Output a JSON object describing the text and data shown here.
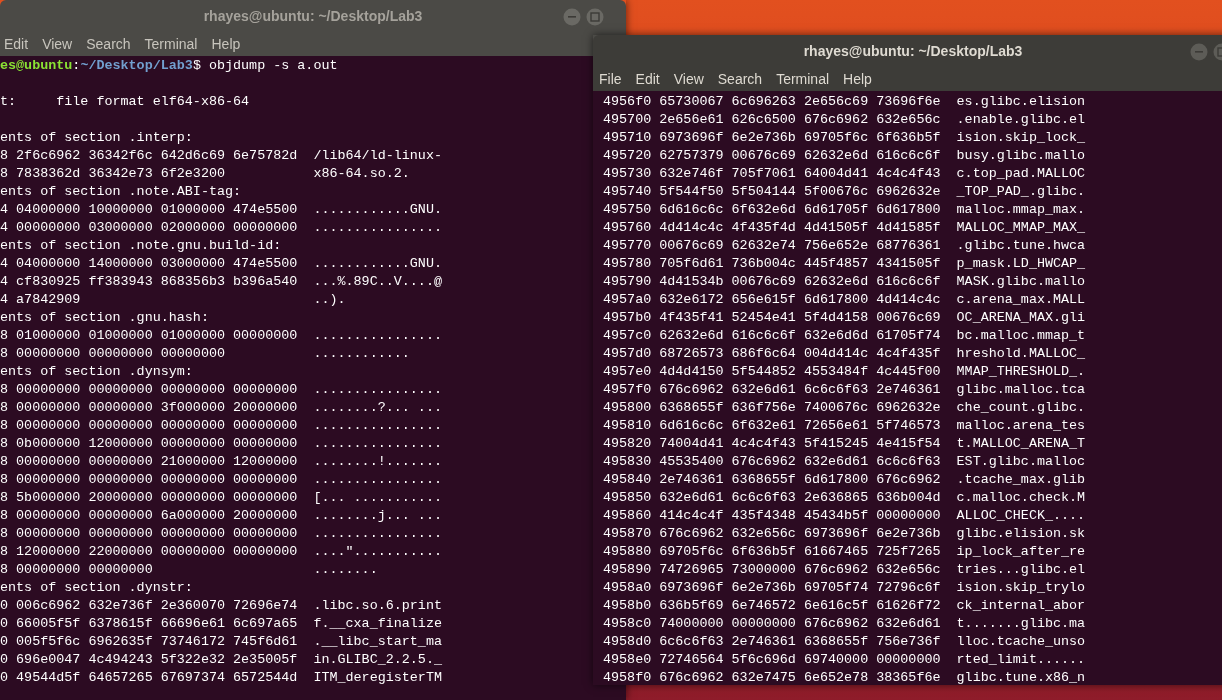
{
  "windows": [
    {
      "title": "rhayes@ubuntu: ~/Desktop/Lab3",
      "focused": false,
      "menu": [
        "Edit",
        "View",
        "Search",
        "Terminal",
        "Help"
      ],
      "prompt": {
        "user": "es@ubuntu",
        "separator": ":",
        "path": "~/Desktop/Lab3",
        "command": "$ objdump -s a.out"
      },
      "lines": [
        {
          "kind": "blank"
        },
        {
          "kind": "text",
          "text": "t:     file format elf64-x86-64"
        },
        {
          "kind": "blank"
        },
        {
          "kind": "text",
          "text": "ents of section .interp:"
        },
        {
          "kind": "text",
          "text": "8 2f6c6962 36342f6c 642d6c69 6e75782d  /lib64/ld-linux-"
        },
        {
          "kind": "text",
          "text": "8 7838362d 36342e73 6f2e3200           x86-64.so.2."
        },
        {
          "kind": "text",
          "text": "ents of section .note.ABI-tag:"
        },
        {
          "kind": "text",
          "text": "4 04000000 10000000 01000000 474e5500  ............GNU."
        },
        {
          "kind": "text",
          "text": "4 00000000 03000000 02000000 00000000  ................"
        },
        {
          "kind": "text",
          "text": "ents of section .note.gnu.build-id:"
        },
        {
          "kind": "text",
          "text": "4 04000000 14000000 03000000 474e5500  ............GNU."
        },
        {
          "kind": "text",
          "text": "4 cf830925 ff383943 868356b3 b396a540  ...%.89C..V....@"
        },
        {
          "kind": "text",
          "text": "4 a7842909                             ..)."
        },
        {
          "kind": "text",
          "text": "ents of section .gnu.hash:"
        },
        {
          "kind": "text",
          "text": "8 01000000 01000000 01000000 00000000  ................"
        },
        {
          "kind": "text",
          "text": "8 00000000 00000000 00000000           ............"
        },
        {
          "kind": "text",
          "text": "ents of section .dynsym:"
        },
        {
          "kind": "text",
          "text": "8 00000000 00000000 00000000 00000000  ................"
        },
        {
          "kind": "text",
          "text": "8 00000000 00000000 3f000000 20000000  ........?... ..."
        },
        {
          "kind": "text",
          "text": "8 00000000 00000000 00000000 00000000  ................"
        },
        {
          "kind": "text",
          "text": "8 0b000000 12000000 00000000 00000000  ................"
        },
        {
          "kind": "text",
          "text": "8 00000000 00000000 21000000 12000000  ........!......."
        },
        {
          "kind": "text",
          "text": "8 00000000 00000000 00000000 00000000  ................"
        },
        {
          "kind": "text",
          "text": "8 5b000000 20000000 00000000 00000000  [... ..........."
        },
        {
          "kind": "text",
          "text": "8 00000000 00000000 6a000000 20000000  ........j... ..."
        },
        {
          "kind": "text",
          "text": "8 00000000 00000000 00000000 00000000  ................"
        },
        {
          "kind": "text",
          "text": "8 12000000 22000000 00000000 00000000  ....\"..........."
        },
        {
          "kind": "text",
          "text": "8 00000000 00000000                    ........"
        },
        {
          "kind": "text",
          "text": "ents of section .dynstr:"
        },
        {
          "kind": "text",
          "text": "0 006c6962 632e736f 2e360070 72696e74  .libc.so.6.print"
        },
        {
          "kind": "text",
          "text": "0 66005f5f 6378615f 66696e61 6c697a65  f.__cxa_finalize"
        },
        {
          "kind": "text",
          "text": "0 005f5f6c 6962635f 73746172 745f6d61  .__libc_start_ma"
        },
        {
          "kind": "text",
          "text": "0 696e0047 4c494243 5f322e32 2e35005f  in.GLIBC_2.2.5._"
        },
        {
          "kind": "text",
          "text": "0 49544d5f 64657265 67697374 6572544d  ITM_deregisterTM"
        }
      ]
    },
    {
      "title": "rhayes@ubuntu: ~/Desktop/Lab3",
      "focused": true,
      "menu": [
        "File",
        "Edit",
        "View",
        "Search",
        "Terminal",
        "Help"
      ],
      "lines": [
        {
          "kind": "text",
          "text": "4956f0 65730067 6c696263 2e656c69 73696f6e  es.glibc.elision"
        },
        {
          "kind": "text",
          "text": "495700 2e656e61 626c6500 676c6962 632e656c  .enable.glibc.el"
        },
        {
          "kind": "text",
          "text": "495710 6973696f 6e2e736b 69705f6c 6f636b5f  ision.skip_lock_"
        },
        {
          "kind": "text",
          "text": "495720 62757379 00676c69 62632e6d 616c6c6f  busy.glibc.mallo"
        },
        {
          "kind": "text",
          "text": "495730 632e746f 705f7061 64004d41 4c4c4f43  c.top_pad.MALLOC"
        },
        {
          "kind": "text",
          "text": "495740 5f544f50 5f504144 5f00676c 6962632e  _TOP_PAD_.glibc."
        },
        {
          "kind": "text",
          "text": "495750 6d616c6c 6f632e6d 6d61705f 6d617800  malloc.mmap_max."
        },
        {
          "kind": "text",
          "text": "495760 4d414c4c 4f435f4d 4d41505f 4d41585f  MALLOC_MMAP_MAX_"
        },
        {
          "kind": "text",
          "text": "495770 00676c69 62632e74 756e652e 68776361  .glibc.tune.hwca"
        },
        {
          "kind": "text",
          "text": "495780 705f6d61 736b004c 445f4857 4341505f  p_mask.LD_HWCAP_"
        },
        {
          "kind": "text",
          "text": "495790 4d41534b 00676c69 62632e6d 616c6c6f  MASK.glibc.mallo"
        },
        {
          "kind": "text",
          "text": "4957a0 632e6172 656e615f 6d617800 4d414c4c  c.arena_max.MALL"
        },
        {
          "kind": "text",
          "text": "4957b0 4f435f41 52454e41 5f4d4158 00676c69  OC_ARENA_MAX.gli"
        },
        {
          "kind": "text",
          "text": "4957c0 62632e6d 616c6c6f 632e6d6d 61705f74  bc.malloc.mmap_t"
        },
        {
          "kind": "text",
          "text": "4957d0 68726573 686f6c64 004d414c 4c4f435f  hreshold.MALLOC_"
        },
        {
          "kind": "text",
          "text": "4957e0 4d4d4150 5f544852 4553484f 4c445f00  MMAP_THRESHOLD_."
        },
        {
          "kind": "text",
          "text": "4957f0 676c6962 632e6d61 6c6c6f63 2e746361  glibc.malloc.tca"
        },
        {
          "kind": "text",
          "text": "495800 6368655f 636f756e 7400676c 6962632e  che_count.glibc."
        },
        {
          "kind": "text",
          "text": "495810 6d616c6c 6f632e61 72656e61 5f746573  malloc.arena_tes"
        },
        {
          "kind": "text",
          "text": "495820 74004d41 4c4c4f43 5f415245 4e415f54  t.MALLOC_ARENA_T"
        },
        {
          "kind": "text",
          "text": "495830 45535400 676c6962 632e6d61 6c6c6f63  EST.glibc.malloc"
        },
        {
          "kind": "text",
          "text": "495840 2e746361 6368655f 6d617800 676c6962  .tcache_max.glib"
        },
        {
          "kind": "text",
          "text": "495850 632e6d61 6c6c6f63 2e636865 636b004d  c.malloc.check.M"
        },
        {
          "kind": "text",
          "text": "495860 414c4c4f 435f4348 45434b5f 00000000  ALLOC_CHECK_...."
        },
        {
          "kind": "text",
          "text": "495870 676c6962 632e656c 6973696f 6e2e736b  glibc.elision.sk"
        },
        {
          "kind": "text",
          "text": "495880 69705f6c 6f636b5f 61667465 725f7265  ip_lock_after_re"
        },
        {
          "kind": "text",
          "text": "495890 74726965 73000000 676c6962 632e656c  tries...glibc.el"
        },
        {
          "kind": "text",
          "text": "4958a0 6973696f 6e2e736b 69705f74 72796c6f  ision.skip_trylo"
        },
        {
          "kind": "text",
          "text": "4958b0 636b5f69 6e746572 6e616c5f 61626f72  ck_internal_abor"
        },
        {
          "kind": "text",
          "text": "4958c0 74000000 00000000 676c6962 632e6d61  t.......glibc.ma"
        },
        {
          "kind": "text",
          "text": "4958d0 6c6c6f63 2e746361 6368655f 756e736f  lloc.tcache_unso"
        },
        {
          "kind": "text",
          "text": "4958e0 72746564 5f6c696d 69740000 00000000  rted_limit......"
        },
        {
          "kind": "text",
          "text": "4958f0 676c6962 632e7475 6e652e78 38365f6e  glibc.tune.x86_n"
        }
      ]
    }
  ]
}
